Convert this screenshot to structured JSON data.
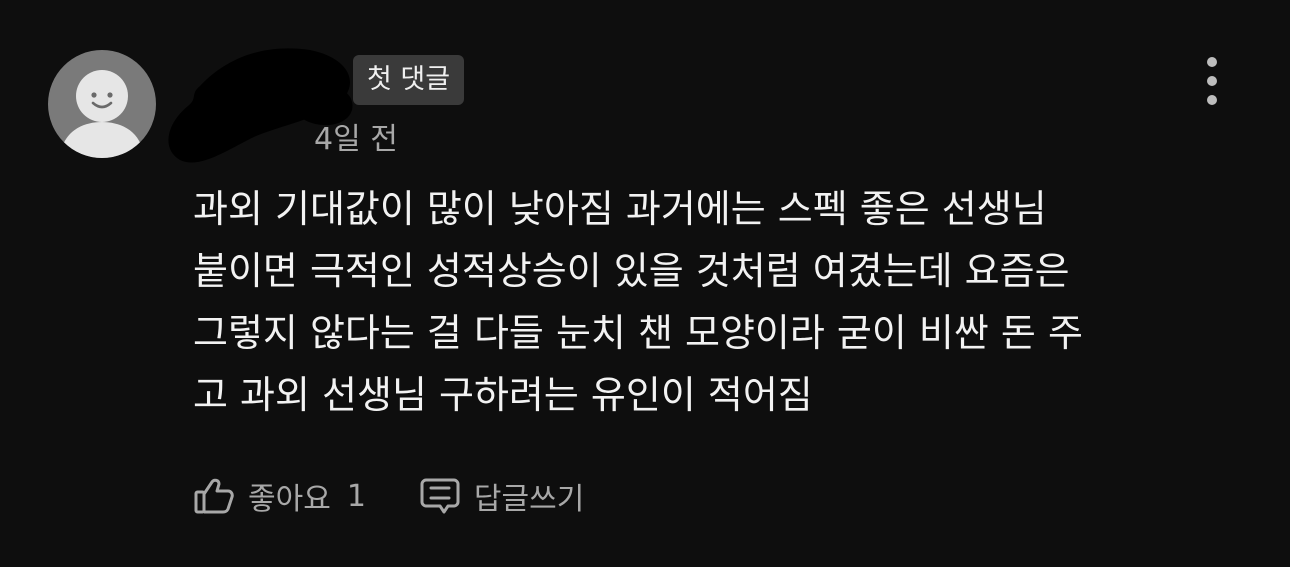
{
  "comment": {
    "badge_label": "첫 댓글",
    "timestamp": "4일 전",
    "body_lines": [
      "과외 기대값이 많이 낮아짐 과거에는 스펙 좋은 선생님",
      "붙이면 극적인 성적상승이 있을 것처럼 여겼는데 요즘은",
      "그렇지 않다는 걸 다들 눈치 챈 모양이라 굳이 비싼 돈 주",
      "고 과외 선생님 구하려는 유인이 적어짐"
    ],
    "like_label": "좋아요",
    "like_count": "1",
    "reply_label": "답글쓰기"
  },
  "icons": {
    "avatar": "smiley-avatar-icon",
    "more": "more-vertical-icon",
    "like": "thumbs-up-icon",
    "reply": "reply-bubble-icon"
  },
  "colors": {
    "background": "#0e0e0e",
    "avatar": "#7a7a7a",
    "badge_bg": "#3a3a3a",
    "primary_text": "#f2f2f2",
    "secondary_text": "#a8a8a8"
  }
}
